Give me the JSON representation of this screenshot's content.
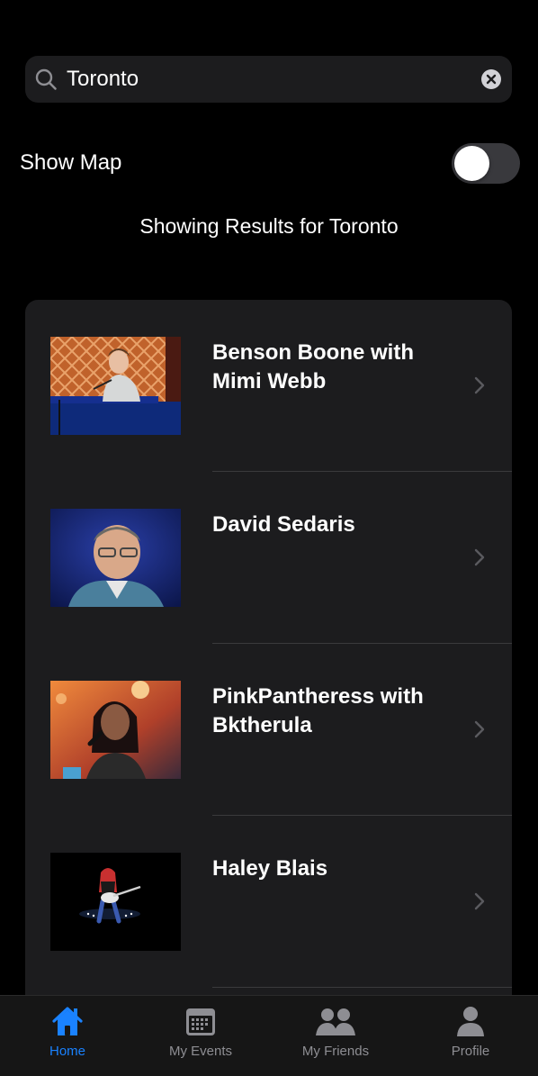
{
  "search": {
    "value": "Toronto",
    "icon": "search-icon",
    "clear_icon": "clear-icon"
  },
  "show_map": {
    "label": "Show Map",
    "enabled": false
  },
  "results_heading": "Showing Results for Toronto",
  "events": [
    {
      "title": "Benson Boone with Mimi Webb"
    },
    {
      "title": "David Sedaris"
    },
    {
      "title": "PinkPantheress with Bktherula"
    },
    {
      "title": "Haley Blais"
    }
  ],
  "tabbar": {
    "tabs": [
      {
        "label": "Home",
        "icon": "home-icon",
        "active": true
      },
      {
        "label": "My Events",
        "icon": "calendar-icon",
        "active": false
      },
      {
        "label": "My Friends",
        "icon": "friends-icon",
        "active": false
      },
      {
        "label": "Profile",
        "icon": "profile-icon",
        "active": false
      }
    ]
  },
  "colors": {
    "background": "#000000",
    "card": "#1c1c1e",
    "accent": "#1a82ff",
    "inactive": "#8e8e93",
    "toggle_off": "#39393d"
  }
}
